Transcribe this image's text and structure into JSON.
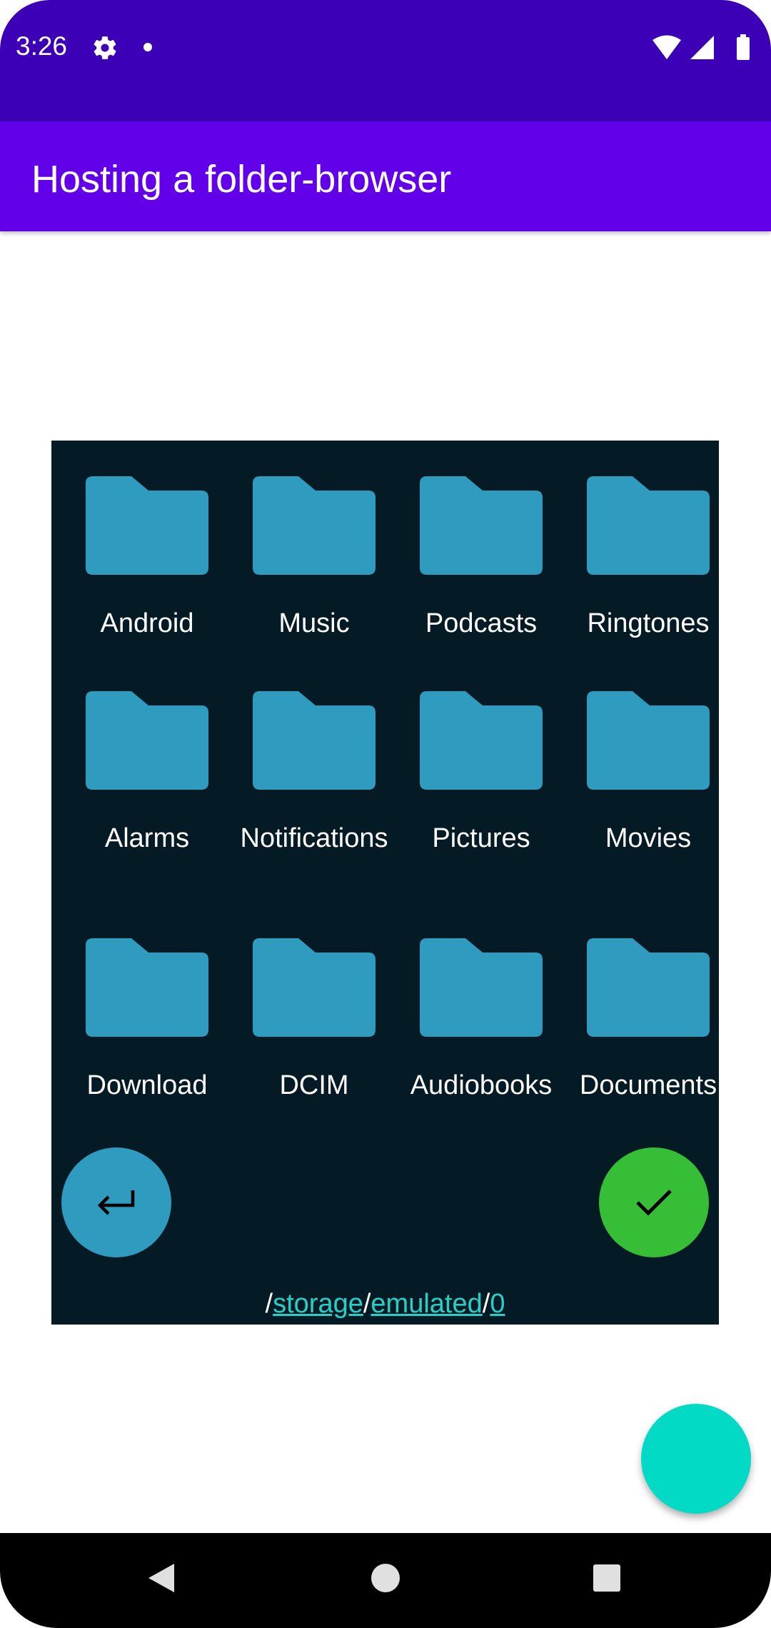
{
  "status_bar": {
    "time": "3:26",
    "icons": [
      "gear-icon",
      "notification-dot-icon",
      "wifi-icon",
      "signal-icon",
      "battery-icon"
    ]
  },
  "app_bar": {
    "title": "Hosting a folder-browser"
  },
  "folders": [
    {
      "name": "Android"
    },
    {
      "name": "Music"
    },
    {
      "name": "Podcasts"
    },
    {
      "name": "Ringtones"
    },
    {
      "name": "Alarms"
    },
    {
      "name": "Notifications"
    },
    {
      "name": "Pictures"
    },
    {
      "name": "Movies"
    },
    {
      "name": "Download"
    },
    {
      "name": "DCIM"
    },
    {
      "name": "Audiobooks"
    },
    {
      "name": "Documents"
    }
  ],
  "path": {
    "root": "/",
    "segments": [
      "storage",
      "emulated",
      "0"
    ],
    "separator": "/"
  },
  "buttons": {
    "back_icon": "return-arrow-icon",
    "confirm_icon": "checkmark-icon"
  },
  "colors": {
    "status_bar": "#3c00b6",
    "app_bar": "#6200ea",
    "browser_bg": "#041b26",
    "folder": "#2e9bbf",
    "confirm": "#36bf36",
    "fab": "#03dac5",
    "link": "#27d0c6"
  }
}
